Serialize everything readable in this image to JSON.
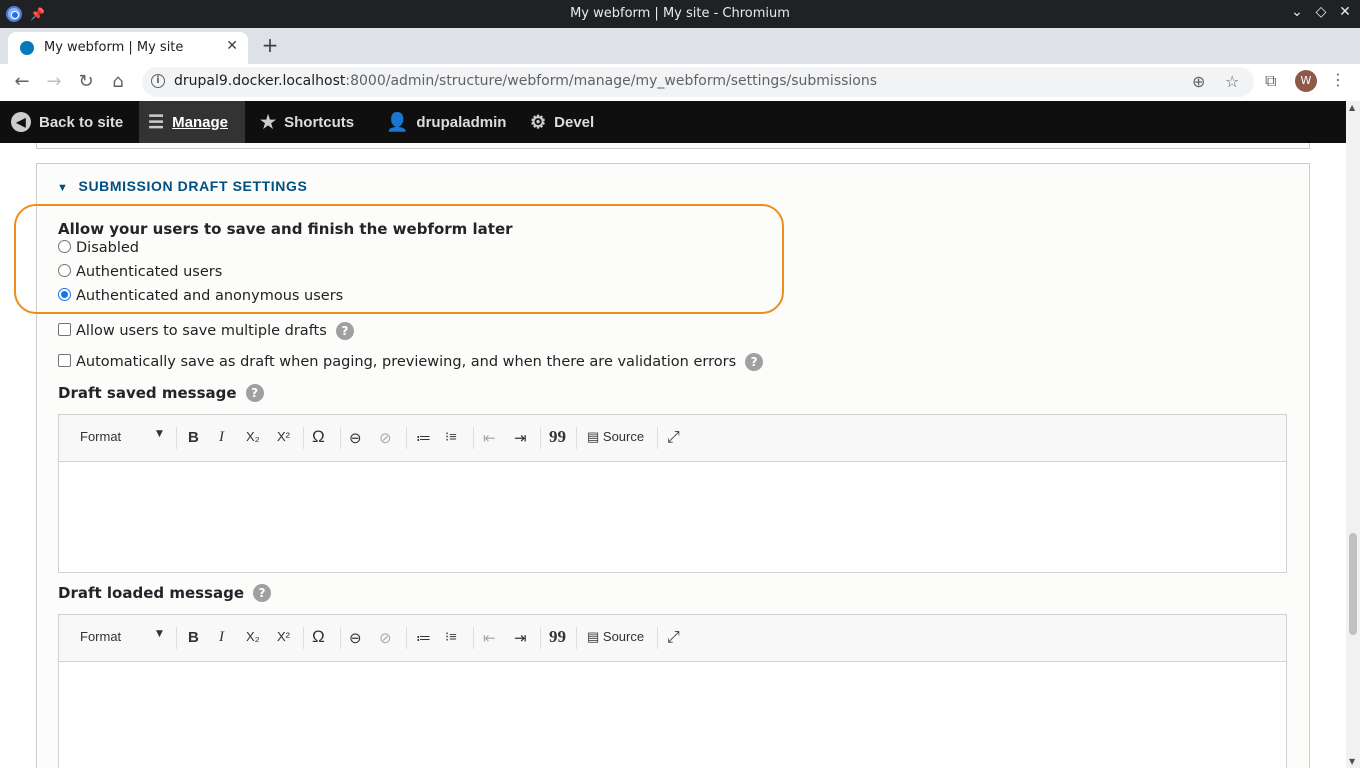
{
  "window": {
    "title": "My webform | My site - Chromium",
    "controls": [
      "chevron-down-icon",
      "diamond-icon",
      "close-icon"
    ]
  },
  "tab": {
    "title": "My webform | My site",
    "close": "✕",
    "new_tab": "+"
  },
  "address_bar": {
    "host": "drupal9.docker.localhost",
    "rest": ":8000/admin/structure/webform/manage/my_webform/settings/submissions",
    "avatar_letter": "W"
  },
  "admin_toolbar": {
    "back": "Back to site",
    "manage": "Manage",
    "shortcuts": "Shortcuts",
    "user": "drupaladmin",
    "devel": "Devel"
  },
  "section": {
    "legend": "SUBMISSION DRAFT SETTINGS",
    "draft_label": "Allow your users to save and finish the webform later",
    "options": [
      {
        "label": "Disabled",
        "checked": false
      },
      {
        "label": "Authenticated users",
        "checked": false
      },
      {
        "label": "Authenticated and anonymous users",
        "checked": true
      }
    ],
    "multiple_drafts": "Allow users to save multiple drafts",
    "auto_save": "Automatically save as draft when paging, previewing, and when there are validation errors",
    "draft_saved_label": "Draft saved message",
    "draft_loaded_label": "Draft loaded message",
    "help": "?"
  },
  "editor": {
    "format": "Format",
    "bold": "B",
    "italic": "I",
    "subscript": "X₂",
    "superscript": "X²",
    "special_char": "Ω",
    "link": "⊖",
    "unlink": "⊘",
    "numbered_list": "≔",
    "bulleted_list": "⁝≡",
    "outdent": "⇤",
    "indent": "⇥",
    "blockquote": "99",
    "source": "Source",
    "maximize": "⤢"
  },
  "colors": {
    "accent": "#004f80",
    "highlight": "#ef8d1a",
    "radio_checked": "#1a73e8"
  }
}
